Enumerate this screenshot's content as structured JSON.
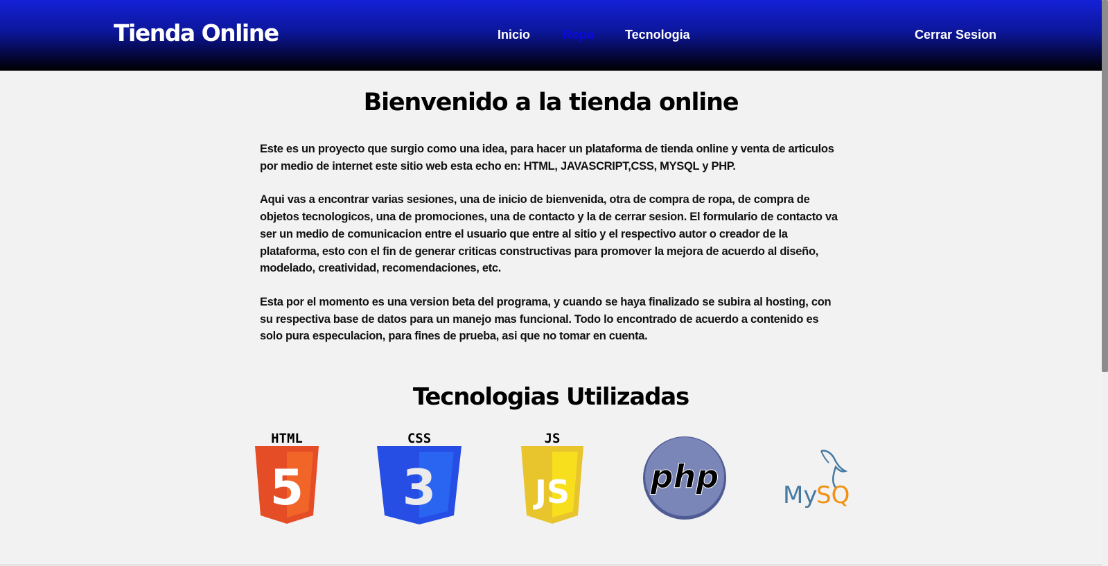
{
  "header": {
    "brand": "Tienda Online",
    "nav": [
      {
        "label": "Inicio"
      },
      {
        "label": "Ropa"
      },
      {
        "label": "Tecnologia"
      }
    ],
    "logout": "Cerrar Sesion",
    "active_item": "Ropa",
    "colors": {
      "gradient_top": "#1421d6",
      "gradient_bottom": "#000000",
      "active_link": "#0a0ae0"
    }
  },
  "main": {
    "title": "Bienvenido a la tienda online",
    "p1": {
      "text": "Este es un proyecto que surgio como una idea, para hacer un plataforma de tienda online y venta de articulos por medio de internet este sitio web esta echo en: ",
      "html": "HTML",
      "js": "JAVASCRIPT",
      "css": "CSS",
      "mysql": "MYSQL",
      "y": " y ",
      "php": "PHP"
    },
    "p2": "Aqui vas a encontrar varias sesiones, una de inicio de bienvenida, otra de compra de ropa, de compra de objetos tecnologicos, una de promociones, una de contacto y la de cerrar sesion. El formulario de contacto va ser un medio de comunicacion entre el usuario que entre al sitio y el respectivo autor o creador de la plataforma, esto con el fin de generar criticas constructivas para promover la mejora de acuerdo al diseño, modelado, creatividad, recomendaciones, etc.",
    "p3": "Esta por el momento es una version beta del programa, y cuando se haya finalizado se subira al hosting, con su respectiva base de datos para un manejo mas funcional. Todo lo encontrado de acuerdo a contenido es solo pura especulacion, para fines de prueba, asi que no tomar en cuenta.",
    "tech_title": "Tecnologias Utilizadas"
  },
  "logos": {
    "html": {
      "caption": "HTML",
      "glyph": "5",
      "icon": "html5-icon",
      "color": "#e44d26"
    },
    "css": {
      "caption": "CSS",
      "glyph": "3",
      "icon": "css3-icon",
      "color": "#264de4"
    },
    "js": {
      "caption": "JS",
      "glyph": "JS",
      "icon": "js-icon",
      "color": "#e8c52d"
    },
    "php": {
      "label": "php",
      "icon": "php-icon",
      "color": "#7a86b8"
    },
    "mysql": {
      "label_a": "My",
      "label_b": "SQL",
      "icon": "mysql-icon",
      "color_a": "#4479a1",
      "color_b": "#f29111"
    }
  }
}
